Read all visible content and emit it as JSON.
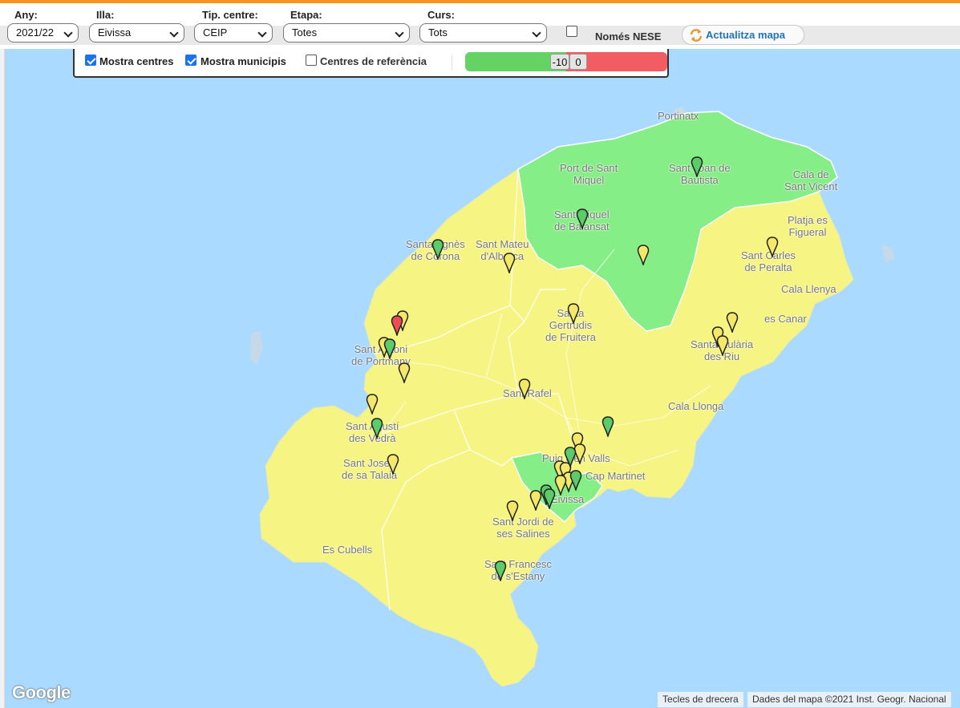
{
  "toolbar": {
    "any": {
      "label": "Any:",
      "value": "2021/22"
    },
    "illa": {
      "label": "Illa:",
      "value": "Eivissa"
    },
    "tipus": {
      "label": "Tip. centre:",
      "value": "CEIP"
    },
    "etapa": {
      "label": "Etapa:",
      "value": "Totes"
    },
    "curs": {
      "label": "Curs:",
      "value": "Tots"
    },
    "nese": {
      "label": "Només NESE",
      "checked": false
    },
    "refresh_label": "Actualitza mapa"
  },
  "layers": {
    "mostra_centres": {
      "label": "Mostra centres",
      "checked": true
    },
    "mostra_municipis": {
      "label": "Mostra municipis",
      "checked": true
    },
    "centres_referencia": {
      "label": "Centres de referència",
      "checked": false
    },
    "range": {
      "min_label": "-10",
      "max_label": "0"
    }
  },
  "map": {
    "places": [
      {
        "id": "portinatx",
        "text": "Portinatx"
      },
      {
        "id": "port-sant-miquel",
        "text": "Port de Sant\nMiquel"
      },
      {
        "id": "sant-joan",
        "text": "Sant Joan de\nBautista"
      },
      {
        "id": "cala-sant-vicent",
        "text": "Cala de\nSant Vicent"
      },
      {
        "id": "sant-miquel",
        "text": "Sant Miquel\nde Balansat"
      },
      {
        "id": "platja-figueral",
        "text": "Platja es\nFigueral"
      },
      {
        "id": "santa-agnes",
        "text": "Santa Agnès\nde Corona"
      },
      {
        "id": "sant-mateu",
        "text": "Sant Mateu\nd'Albarca"
      },
      {
        "id": "sant-carles",
        "text": "Sant Carles\nde Peralta"
      },
      {
        "id": "cala-llenya",
        "text": "Cala Llenya"
      },
      {
        "id": "santa-gertrudis",
        "text": "Santa\nGertrudis\nde Fruitera"
      },
      {
        "id": "es-canar",
        "text": "es Canar"
      },
      {
        "id": "sant-antoni",
        "text": "Sant Antoni\nde Portmany"
      },
      {
        "id": "santa-eularia",
        "text": "Santa Eulària\ndes Riu"
      },
      {
        "id": "sant-rafel",
        "text": "Sant Rafel"
      },
      {
        "id": "cala-llonga",
        "text": "Cala Llonga"
      },
      {
        "id": "sant-agusti",
        "text": "Sant Agustí\ndes Vedrà"
      },
      {
        "id": "puig-pons",
        "text": "Puig d'en Valls"
      },
      {
        "id": "sant-josep",
        "text": "Sant Josep\nde sa Talaia"
      },
      {
        "id": "cap-martinet",
        "text": "Cap Martinet"
      },
      {
        "id": "eivissa",
        "text": "Eivissa"
      },
      {
        "id": "sant-jordi",
        "text": "Sant Jordi de\nses Salines"
      },
      {
        "id": "es-cubells",
        "text": "Es Cubells"
      },
      {
        "id": "sant-francesc",
        "text": "Sant Francesc\nde s'Estany"
      }
    ],
    "marker_colors": {
      "yellow": "#f4e86a",
      "green": "#5ccb6a",
      "red": "#f04a56"
    },
    "marker_count": 37,
    "attribution_shortcuts": "Tecles de drecera",
    "attribution_data": "Dades del mapa ©2021 Inst. Geogr. Nacional",
    "logo": "Google"
  }
}
